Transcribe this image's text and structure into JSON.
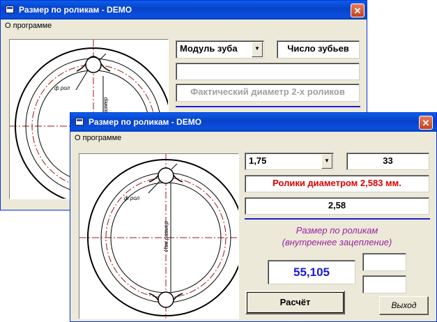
{
  "back_window": {
    "title": "Размер по роликам - DEMO",
    "close_glyph": "✕",
    "menu": [
      "О программе"
    ],
    "module_select": "Модуль зуба",
    "teeth_field": "Число зубьев",
    "roller_field": "",
    "diameter_placeholder": "Фактический диаметр 2-х роликов",
    "drawing": {
      "roller_label": "ф рол",
      "size_label": "Размер"
    }
  },
  "front_window": {
    "title": "Размер по роликам - DEMO",
    "close_glyph": "✕",
    "menu": [
      "О программе"
    ],
    "module_value": "1,75",
    "teeth_value": "33",
    "roller_info": "Ролики диаметром 2,583 мм.",
    "roller_diameter": "2,58",
    "result_title_line1": "Размер по роликам",
    "result_title_line2": "(внутреннее зацепление)",
    "result_value": "55,105",
    "extra_field_1": "",
    "extra_field_2": "",
    "calc_button": "Расчёт",
    "exit_button": "Выход",
    "drawing": {
      "roller_label": "ф рол",
      "size_label": "Изм.размер"
    }
  },
  "colors": {
    "titlebar": "#0a50e0",
    "roller_info_text": "#e00000",
    "result_value_text": "#1a1ad0",
    "result_title_text": "#9b1fa0",
    "divider": "#1f1fd0",
    "centerline": "#a01414"
  }
}
